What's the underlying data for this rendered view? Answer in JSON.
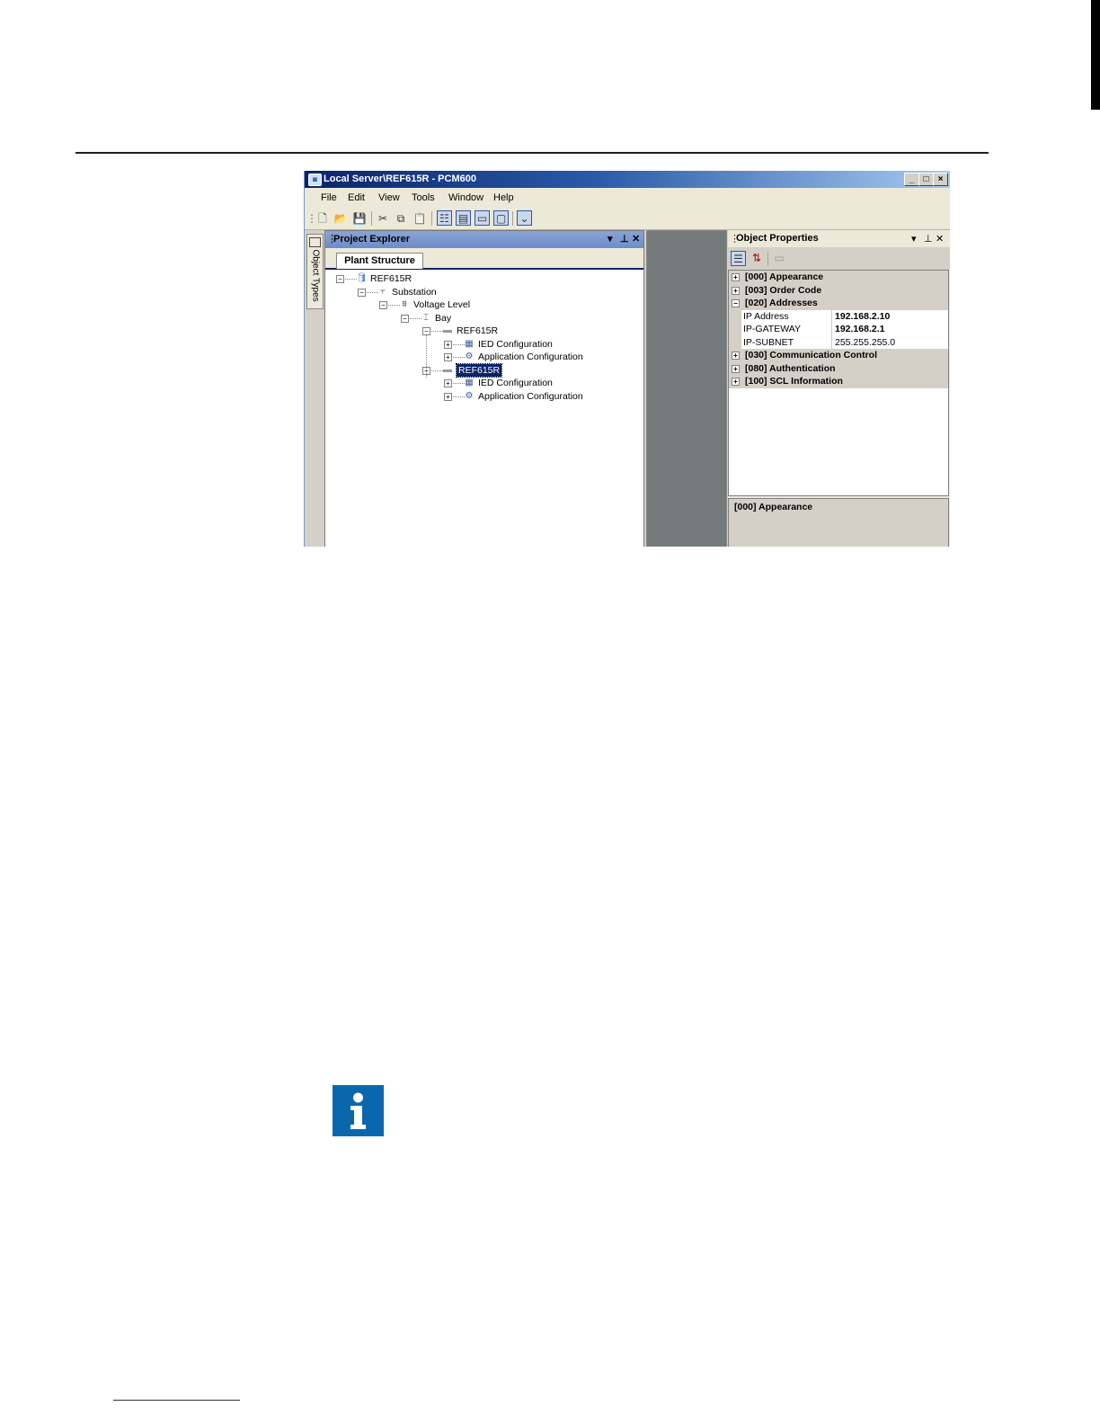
{
  "window": {
    "title": "Local Server\\REF615R - PCM600",
    "buttons": [
      "_",
      "□",
      "×"
    ]
  },
  "menu": [
    "File",
    "Edit",
    "View",
    "Tools",
    "Window",
    "Help"
  ],
  "left_strip": {
    "tab_label": "Object Types"
  },
  "project_explorer": {
    "title": "Project Explorer",
    "header_controls": [
      "▾",
      "⊥",
      "✕"
    ],
    "tab": "Plant Structure",
    "tree": [
      {
        "label": "REF615R",
        "icon": "database-icon",
        "level": 0,
        "expander": "−"
      },
      {
        "label": "Substation",
        "icon": "substation-icon",
        "level": 1,
        "expander": "−"
      },
      {
        "label": "Voltage Level",
        "icon": "voltage-level-icon",
        "level": 2,
        "expander": "−"
      },
      {
        "label": "Bay",
        "icon": "bay-icon",
        "level": 3,
        "expander": "−"
      },
      {
        "label": "REF615R",
        "icon": "ied-icon",
        "level": 4,
        "expander": "−"
      },
      {
        "label": "IED Configuration",
        "icon": "ied-configuration-icon",
        "level": 5,
        "expander": "+"
      },
      {
        "label": "Application Configuration",
        "icon": "application-configuration-icon",
        "level": 5,
        "expander": "+"
      },
      {
        "label": "REF615R",
        "icon": "ied-icon",
        "level": 4,
        "expander": "−",
        "selected": true
      },
      {
        "label": "IED Configuration",
        "icon": "ied-configuration-icon",
        "level": 5,
        "expander": "+"
      },
      {
        "label": "Application Configuration",
        "icon": "application-configuration-icon",
        "level": 5,
        "expander": "+"
      }
    ]
  },
  "object_properties": {
    "title": "Object Properties",
    "header_controls": [
      "▾",
      "⊥",
      "✕"
    ],
    "rows": [
      {
        "type": "category",
        "expander": "+",
        "label": "[000] Appearance"
      },
      {
        "type": "category",
        "expander": "+",
        "label": "[003] Order Code"
      },
      {
        "type": "category",
        "expander": "−",
        "label": "[020] Addresses"
      },
      {
        "type": "property",
        "name": "IP Address",
        "value": "192.168.2.10",
        "bold": true
      },
      {
        "type": "property",
        "name": "IP-GATEWAY",
        "value": "192.168.2.1",
        "bold": true
      },
      {
        "type": "property",
        "name": "IP-SUBNET",
        "value": "255.255.255.0",
        "bold": false
      },
      {
        "type": "category",
        "expander": "+",
        "label": "[030] Communication Control"
      },
      {
        "type": "category",
        "expander": "+",
        "label": "[080] Authentication"
      },
      {
        "type": "category",
        "expander": "+",
        "label": "[100] SCL Information"
      }
    ],
    "description": "[000] Appearance"
  },
  "colors": {
    "title_gradient_start": "#0a246a",
    "info_icon": "#0a67ad"
  }
}
